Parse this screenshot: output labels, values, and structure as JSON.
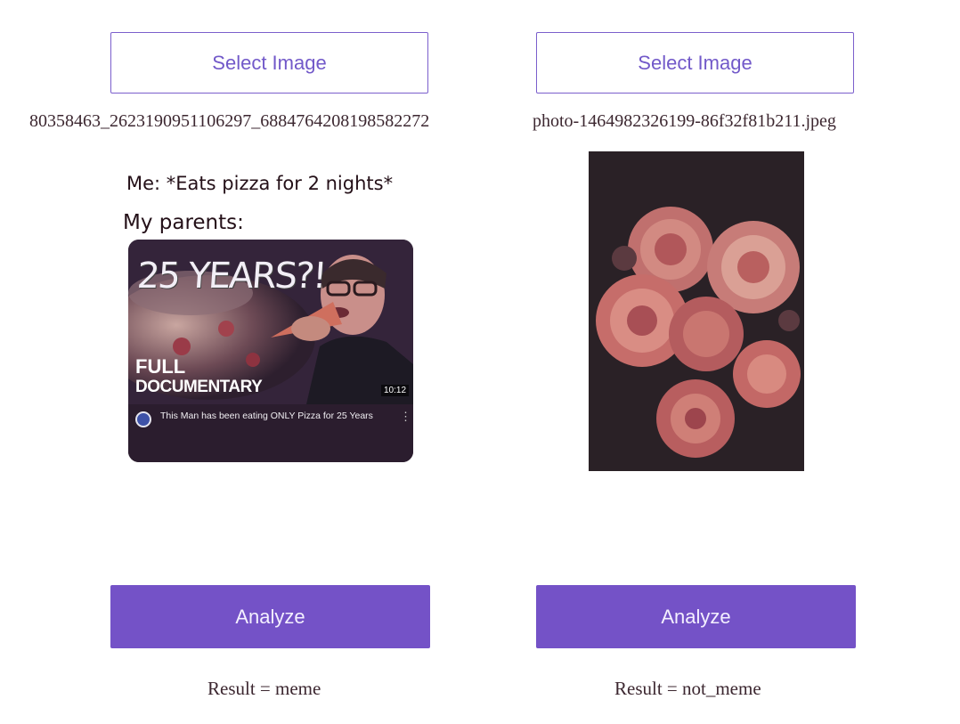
{
  "left_panel": {
    "select_label": "Select Image",
    "filename": "80358463_2623190951106297_6884764208198582272",
    "meme": {
      "line1": "Me: *Eats pizza for 2 nights*",
      "line2": "My parents:",
      "overlay_text": "25 YEARS?!",
      "title_line1": "FULL",
      "title_line2": "DOCUMENTARY",
      "duration": "10:12",
      "caption": "This Man has been eating ONLY Pizza for 25 Years",
      "more": "⋮"
    },
    "analyze_label": "Analyze",
    "result": "Result = meme"
  },
  "right_panel": {
    "select_label": "Select Image",
    "filename": "photo-1464982326199-86f32f81b211.jpeg",
    "analyze_label": "Analyze",
    "result": "Result = not_meme"
  },
  "colors": {
    "accent": "#7452c7",
    "outline": "#7b5fcc",
    "text": "#3c2730"
  }
}
